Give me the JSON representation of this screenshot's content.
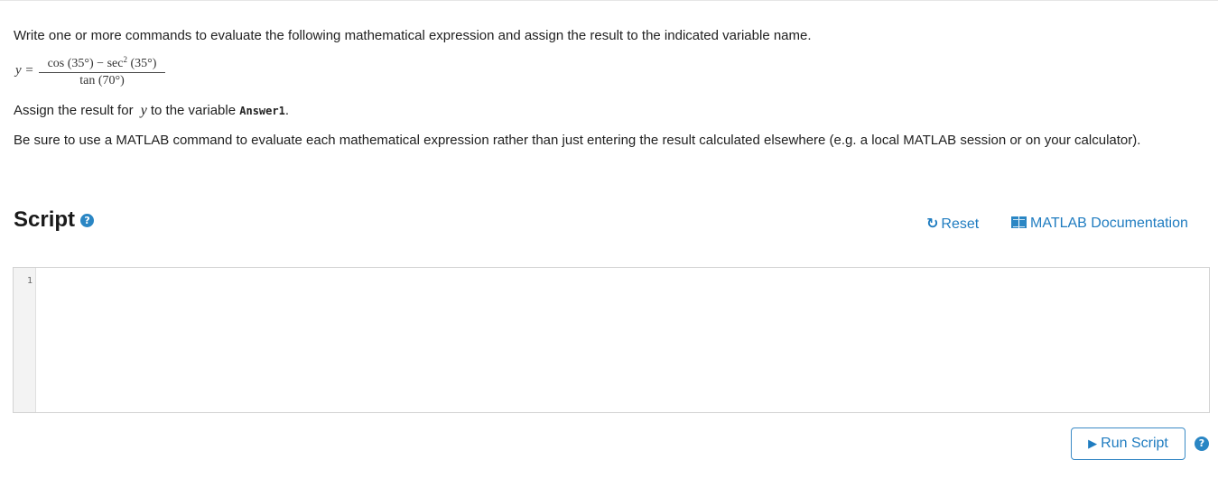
{
  "problem": {
    "intro": "Write one or more commands to evaluate the following mathematical expression and assign the result to the indicated variable name.",
    "equation": {
      "lhs": "y =",
      "numerator": [
        "cos (35°) − sec",
        "2",
        " (35°)"
      ],
      "denominator": "tan (70°)"
    },
    "assign_prefix": "Assign the result for",
    "assign_var": "y",
    "assign_mid": "to the variable",
    "assign_target": "Answer1",
    "assign_suffix": ".",
    "note": "Be sure to use a MATLAB command to evaluate each mathematical expression rather than just entering the result calculated elsewhere (e.g. a local MATLAB session or on your calculator)."
  },
  "script": {
    "title": "Script",
    "help_glyph": "?",
    "reset_label": "Reset",
    "docs_label": "MATLAB Documentation",
    "line_numbers": [
      "1"
    ],
    "code": ""
  },
  "actions": {
    "run_label": "Run Script",
    "help_glyph": "?"
  },
  "colors": {
    "link": "#1f7cc0",
    "icon_blue": "#2a86c4",
    "text": "#212121",
    "gutter": "#f3f3f3"
  },
  "icons": [
    "help-icon",
    "reset-icon",
    "book-icon",
    "play-icon"
  ]
}
